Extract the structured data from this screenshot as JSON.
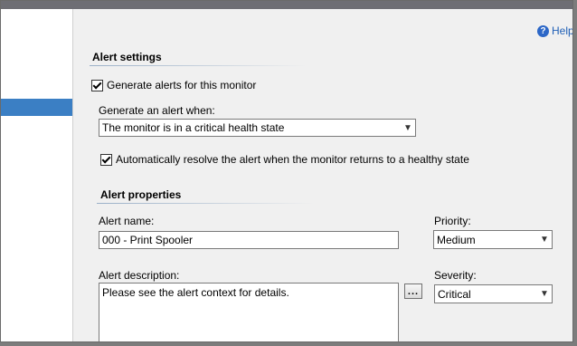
{
  "help": {
    "label": "Help"
  },
  "alert_settings": {
    "title": "Alert settings",
    "generate_alerts_label": "Generate alerts for this monitor",
    "generate_when_label": "Generate an alert when:",
    "generate_when_value": "The monitor is in a critical health state",
    "auto_resolve_label": "Automatically resolve the alert when the monitor returns to a healthy state"
  },
  "alert_properties": {
    "title": "Alert properties",
    "name_label": "Alert name:",
    "name_value": "000 - Print Spooler",
    "priority_label": "Priority:",
    "priority_value": "Medium",
    "description_label": "Alert description:",
    "description_value": "Please see the alert context for details.",
    "description_button": "...",
    "severity_label": "Severity:",
    "severity_value": "Critical"
  }
}
